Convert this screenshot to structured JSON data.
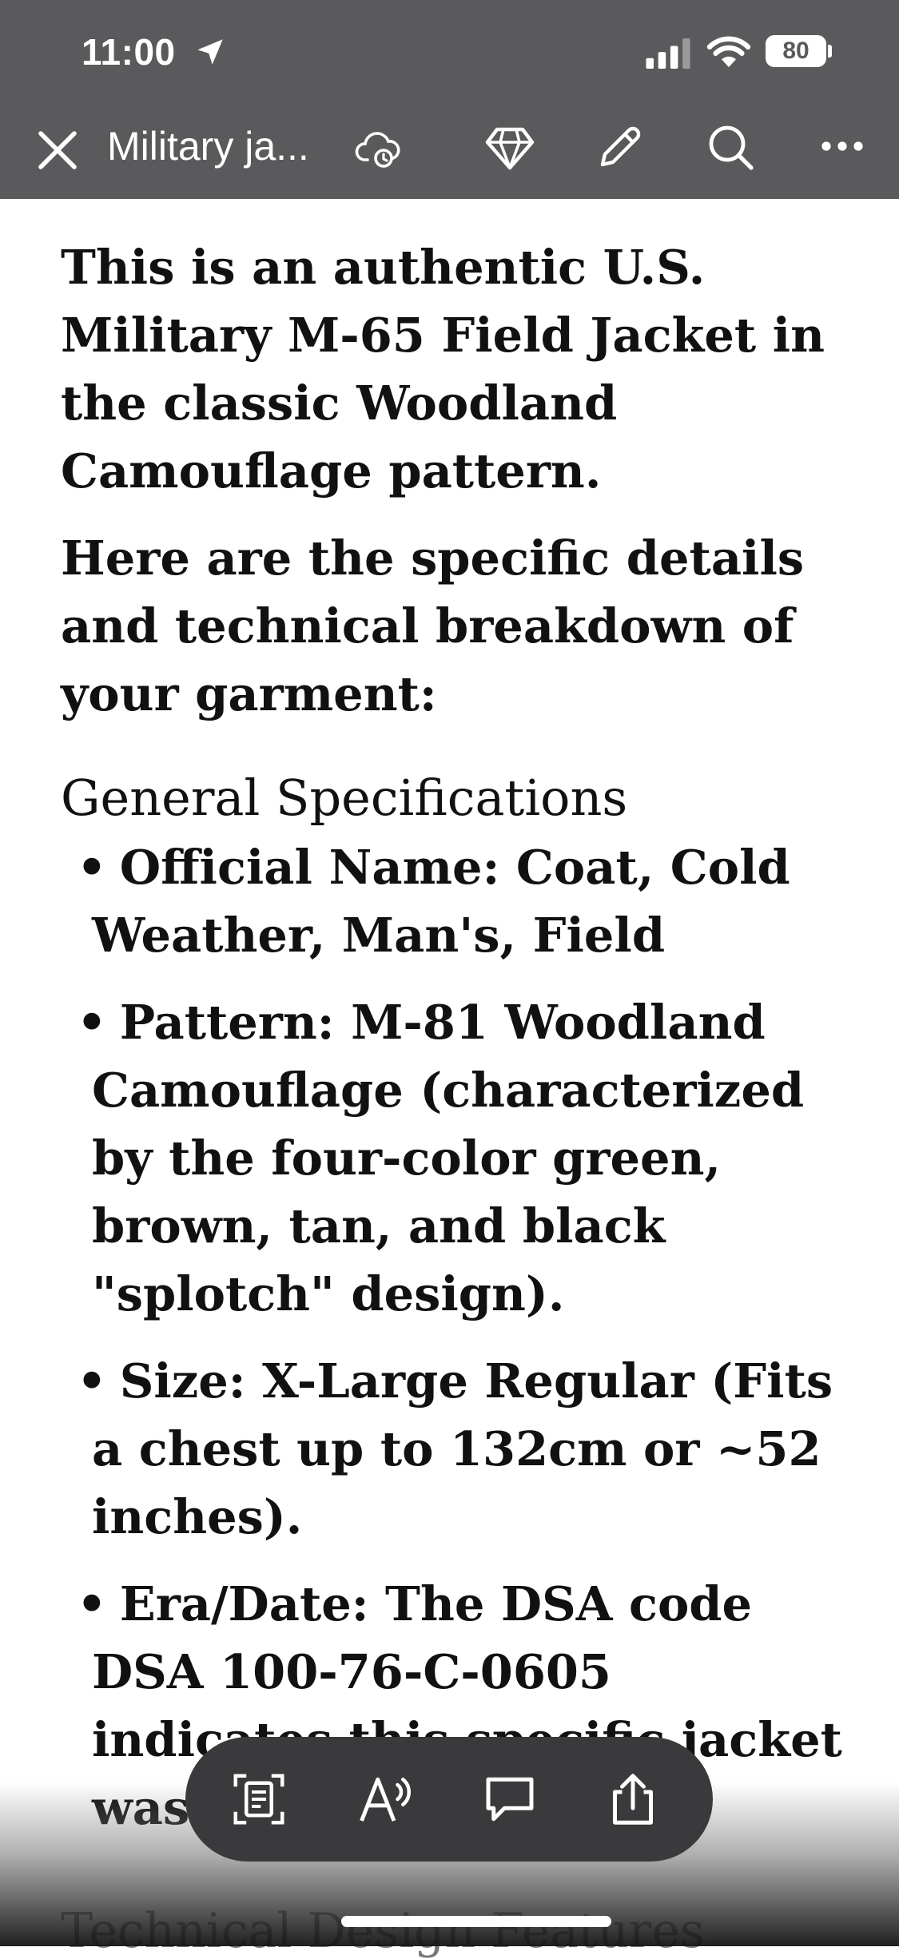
{
  "status_bar": {
    "time": "11:00",
    "battery": "80"
  },
  "toolbar": {
    "title": "Military ja..."
  },
  "document": {
    "intro": "This is an authentic U.S. Military M-65 Field Jacket in the classic Woodland Camouflage pattern.",
    "lead": "Here are the specific details and technical breakdown of your garment:",
    "section_heading": "General Specifications",
    "bullets": [
      "Official Name: Coat, Cold Weather, Man's, Field",
      "Pattern: M-81 Woodland Camouflage (characterized by the four-color green, brown, tan, and black \"splotch\" design).",
      "Size: X-Large Regular (Fits a chest up to 132cm or ~52 inches).",
      "Era/Date: The DSA code DSA 100-76-C-0605 indicates this specific jacket was issu"
    ],
    "next_heading": "Technical Design Features"
  },
  "bottom_bar": {
    "icons": [
      "text-scan-icon",
      "read-aloud-icon",
      "comment-icon",
      "share-icon"
    ]
  },
  "colors": {
    "toolbar_bg": "#5a5a5c",
    "pill_bg": "#3a3a3c",
    "text": "#111111"
  }
}
